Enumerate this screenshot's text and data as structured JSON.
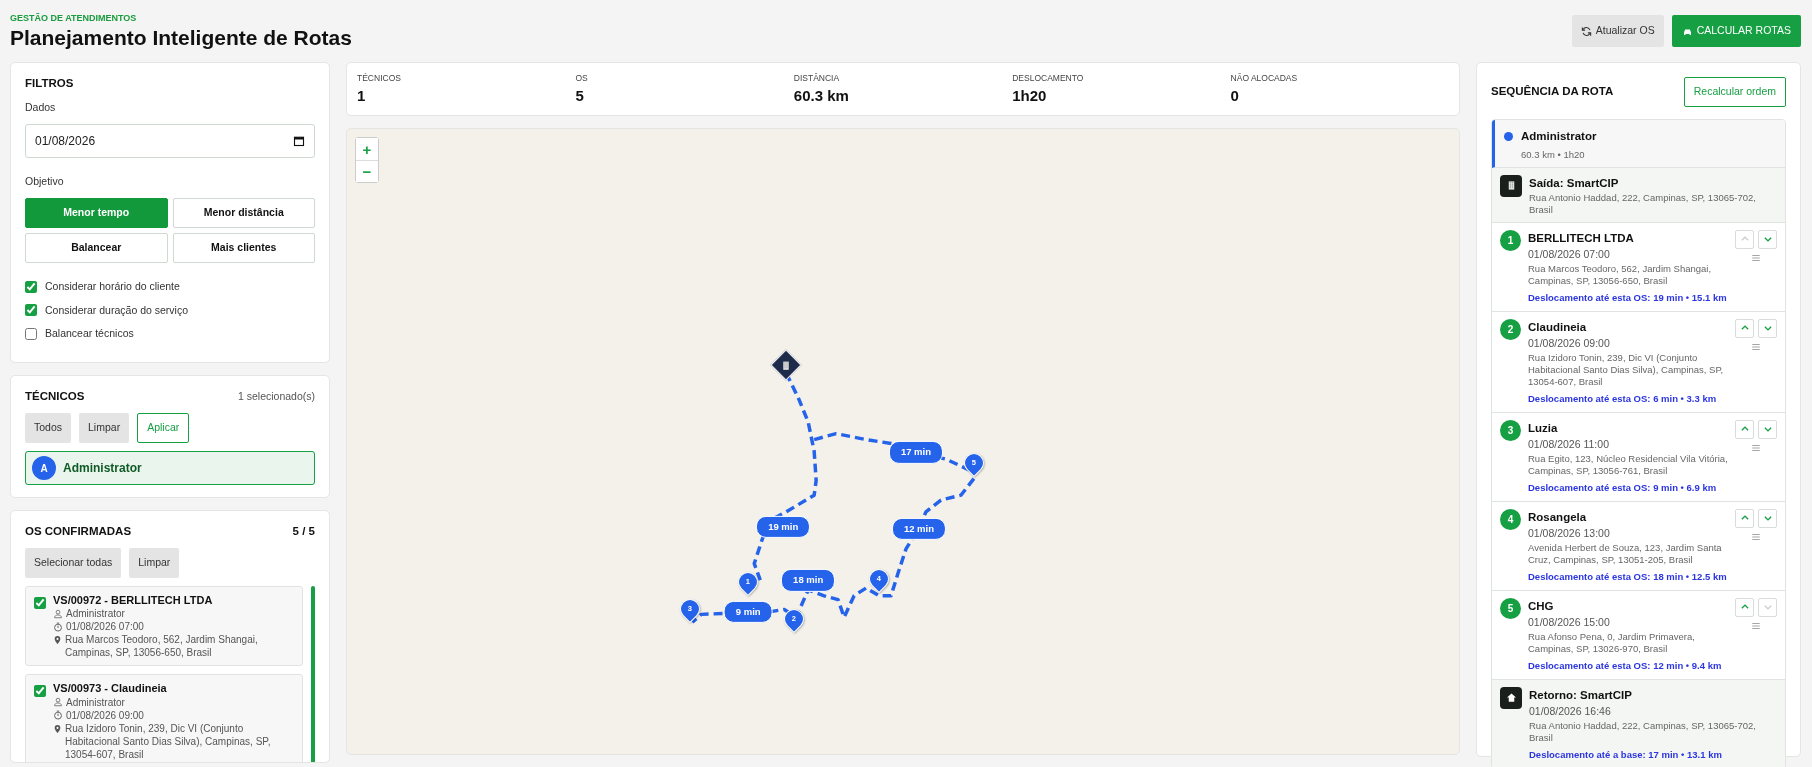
{
  "header": {
    "eyebrow": "GESTÃO DE ATENDIMENTOS",
    "title": "Planejamento Inteligente de Rotas",
    "buttons": [
      {
        "label": "Atualizar OS",
        "kind": "secondary"
      },
      {
        "label": "CALCULAR ROTAS",
        "kind": "primary"
      }
    ]
  },
  "filters": {
    "title": "FILTROS",
    "date_label": "Dados",
    "date_value": "01/08/2026",
    "objective_label": "Objetivo",
    "objectives": [
      {
        "label": "Menor tempo",
        "selected": true
      },
      {
        "label": "Menor distância",
        "selected": false
      },
      {
        "label": "Balancear",
        "selected": false
      },
      {
        "label": "Mais clientes",
        "selected": false
      }
    ],
    "options": [
      {
        "label": "Considerar horário do cliente",
        "checked": true
      },
      {
        "label": "Considerar duração do serviço",
        "checked": true
      },
      {
        "label": "Balancear técnicos",
        "checked": false
      }
    ]
  },
  "technicians": {
    "title": "TÉCNICOS",
    "count": "1 selecionado(s)",
    "buttons": [
      {
        "label": "Todos",
        "kind": "secondary"
      },
      {
        "label": "Limpar",
        "kind": "secondary"
      },
      {
        "label": "Aplicar",
        "kind": "outline"
      }
    ],
    "items": [
      {
        "initial": "A",
        "name": "Administrator",
        "selected": true
      }
    ]
  },
  "orders": {
    "title": "OS CONFIRMADAS",
    "count": "5 / 5",
    "buttons": [
      {
        "label": "Selecionar todas",
        "kind": "secondary"
      },
      {
        "label": "Limpar",
        "kind": "secondary"
      }
    ],
    "items": [
      {
        "title": "VS/00972 - BERLLITECH LTDA",
        "checked": true,
        "technician": "Administrator",
        "datetime": "01/08/2026 07:00",
        "address": "Rua Marcos Teodoro, 562, Jardim Shangai, Campinas, SP, 13056-650, Brasil"
      },
      {
        "title": "VS/00973 - Claudineia",
        "checked": true,
        "technician": "Administrator",
        "datetime": "01/08/2026 09:00",
        "address": "Rua Izidoro Tonin, 239, Dic VI (Conjunto Habitacional Santo Dias Silva), Campinas, SP, 13054-607, Brasil"
      }
    ]
  },
  "stats": [
    {
      "label": "TÉCNICOS",
      "value": "1"
    },
    {
      "label": "OS",
      "value": "5"
    },
    {
      "label": "DISTÂNCIA",
      "value": "60.3 km"
    },
    {
      "label": "DESLOCAMENTO",
      "value": "1h20"
    },
    {
      "label": "NÃO ALOCADAS",
      "value": "0"
    }
  ],
  "map": {
    "zoom_buttons": [
      "+",
      "−"
    ],
    "legs": [
      {
        "label": "17 min"
      },
      {
        "label": "19 min"
      },
      {
        "label": "12 min"
      },
      {
        "label": "18 min"
      },
      {
        "label": "9 min"
      }
    ],
    "stops": [
      {
        "number": "1"
      },
      {
        "number": "2"
      },
      {
        "number": "3"
      },
      {
        "number": "4"
      },
      {
        "number": "5"
      }
    ]
  },
  "route": {
    "title": "SEQUÊNCIA DA ROTA",
    "button": "Recalcular ordem",
    "technician": {
      "name": "Administrator",
      "summary": "60.3 km • 1h20",
      "color": "#2563eb"
    },
    "stops": [
      {
        "kind": "start",
        "name": "Saída: SmartCIP",
        "address": "Rua Antonio Haddad, 222, Campinas, SP, 13065-702, Brasil"
      },
      {
        "kind": "stop",
        "number": "1",
        "name": "BERLLITECH LTDA",
        "datetime": "01/08/2026 07:00",
        "address": "Rua Marcos Teodoro, 562, Jardim Shangai, Campinas, SP, 13056-650, Brasil",
        "travel": "Deslocamento até esta OS: 19 min • 15.1 km",
        "up_disabled": true,
        "down_disabled": false
      },
      {
        "kind": "stop",
        "number": "2",
        "name": "Claudineia",
        "datetime": "01/08/2026 09:00",
        "address": "Rua Izidoro Tonin, 239, Dic VI (Conjunto Habitacional Santo Dias Silva), Campinas, SP, 13054-607, Brasil",
        "travel": "Deslocamento até esta OS: 6 min • 3.3 km",
        "up_disabled": false,
        "down_disabled": false
      },
      {
        "kind": "stop",
        "number": "3",
        "name": "Luzia",
        "datetime": "01/08/2026 11:00",
        "address": "Rua Egito, 123, Núcleo Residencial Vila Vitória, Campinas, SP, 13056-761, Brasil",
        "travel": "Deslocamento até esta OS: 9 min • 6.9 km",
        "up_disabled": false,
        "down_disabled": false
      },
      {
        "kind": "stop",
        "number": "4",
        "name": "Rosangela",
        "datetime": "01/08/2026 13:00",
        "address": "Avenida Herbert de Souza, 123, Jardim Santa Cruz, Campinas, SP, 13051-205, Brasil",
        "travel": "Deslocamento até esta OS: 18 min • 12.5 km",
        "up_disabled": false,
        "down_disabled": false
      },
      {
        "kind": "stop",
        "number": "5",
        "name": "CHG",
        "datetime": "01/08/2026 15:00",
        "address": "Rua Afonso Pena, 0, Jardim Primavera, Campinas, SP, 13026-970, Brasil",
        "travel": "Deslocamento até esta OS: 12 min • 9.4 km",
        "up_disabled": false,
        "down_disabled": true
      },
      {
        "kind": "end",
        "name": "Retorno: SmartCIP",
        "datetime": "01/08/2026 16:46",
        "address": "Rua Antonio Haddad, 222, Campinas, SP, 13065-702, Brasil",
        "travel": "Deslocamento até a base: 17 min • 13.1 km"
      }
    ]
  }
}
